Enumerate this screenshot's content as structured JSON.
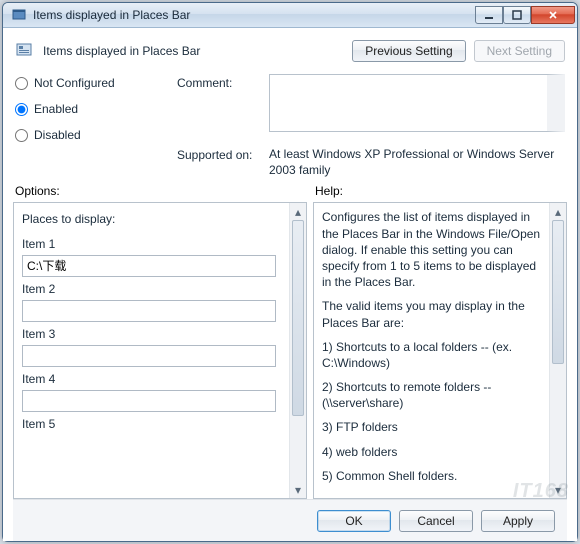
{
  "window": {
    "title": "Items displayed in Places Bar"
  },
  "header": {
    "label": "Items displayed in Places Bar",
    "prev": "Previous Setting",
    "next": "Next Setting"
  },
  "radios": {
    "not_configured": "Not Configured",
    "enabled": "Enabled",
    "disabled": "Disabled",
    "selected": "enabled"
  },
  "meta": {
    "comment_label": "Comment:",
    "comment_value": "",
    "supported_label": "Supported on:",
    "supported_value": "At least Windows XP Professional or Windows Server 2003 family"
  },
  "section_labels": {
    "options": "Options:",
    "help": "Help:"
  },
  "options": {
    "group_title": "Places to display:",
    "items": [
      {
        "label": "Item 1",
        "value": "C:\\下载"
      },
      {
        "label": "Item 2",
        "value": ""
      },
      {
        "label": "Item 3",
        "value": ""
      },
      {
        "label": "Item 4",
        "value": ""
      },
      {
        "label": "Item 5",
        "value": ""
      }
    ]
  },
  "help": {
    "p1": "Configures the list of items displayed in the Places Bar in the Windows File/Open dialog. If enable this setting you can specify from 1 to 5 items to be displayed in the Places Bar.",
    "p2": "The valid items you may display in the Places Bar are:",
    "l1": "1) Shortcuts to a local folders -- (ex. C:\\Windows)",
    "l2": "2) Shortcuts to remote folders -- (\\\\server\\share)",
    "l3": "3) FTP folders",
    "l4": "4) web folders",
    "l5": "5) Common Shell folders."
  },
  "buttons": {
    "ok": "OK",
    "cancel": "Cancel",
    "apply": "Apply"
  },
  "watermark": "IT168"
}
